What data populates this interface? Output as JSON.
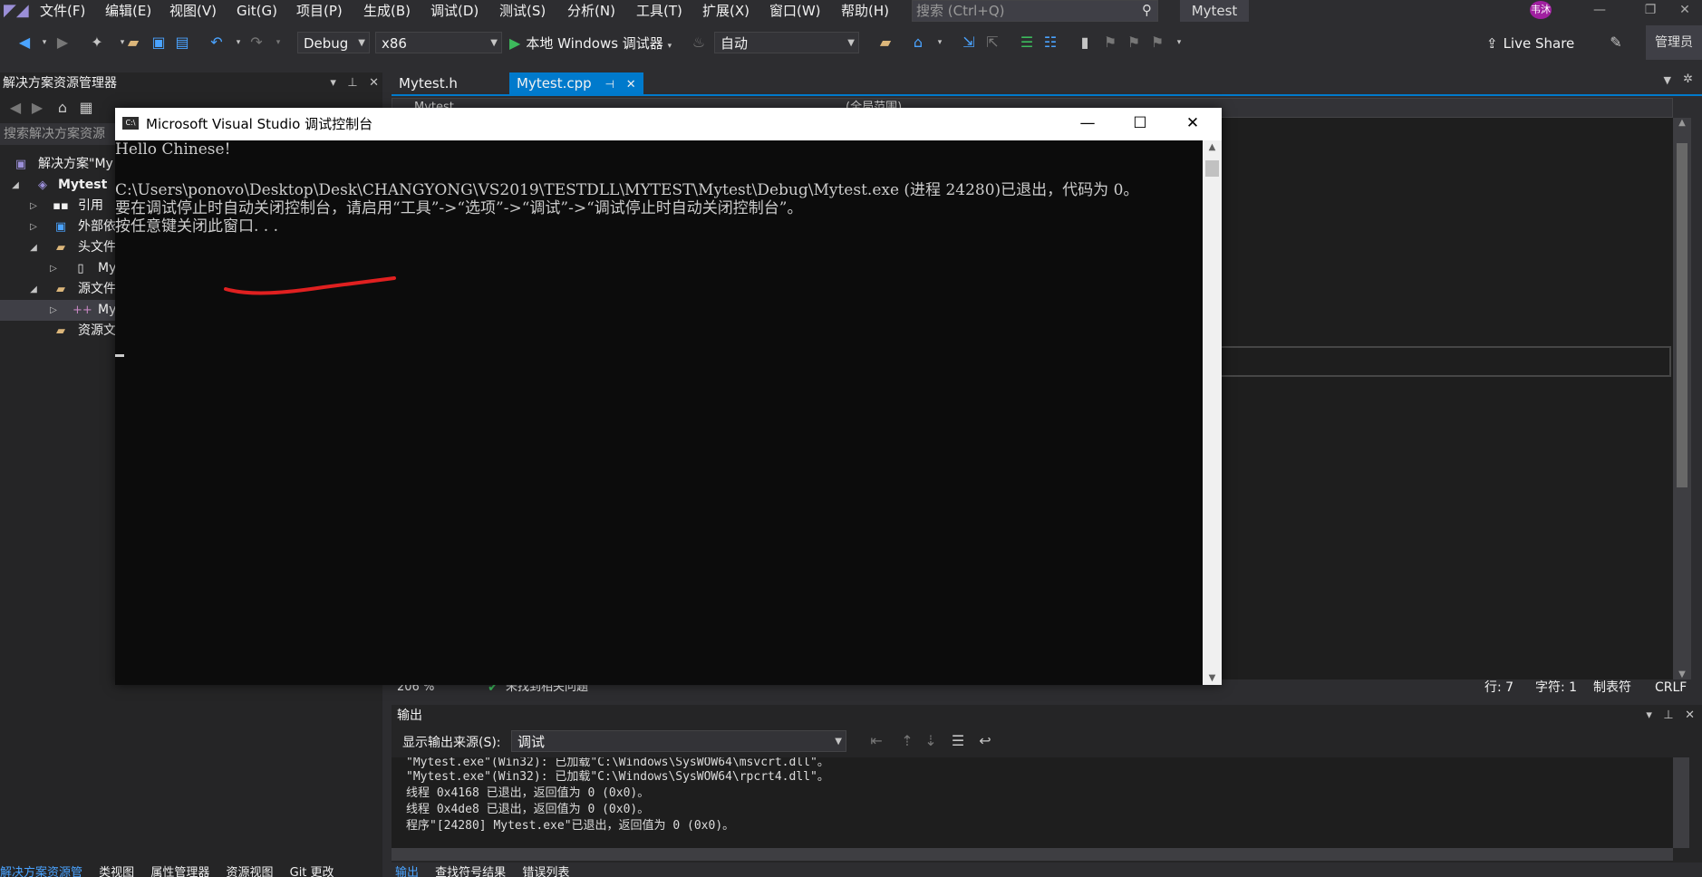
{
  "menubar": {
    "items": [
      "文件(F)",
      "编辑(E)",
      "视图(V)",
      "Git(G)",
      "项目(P)",
      "生成(B)",
      "调试(D)",
      "测试(S)",
      "分析(N)",
      "工具(T)",
      "扩展(X)",
      "窗口(W)",
      "帮助(H)"
    ],
    "search_placeholder": "搜索 (Ctrl+Q)",
    "solution_name": "Mytest",
    "avatar_text": "韦沐"
  },
  "toolbar": {
    "config": "Debug",
    "platform": "x86",
    "run_label": "本地 Windows 调试器",
    "auto": "自动",
    "live_share": "Live Share",
    "admin": "管理员"
  },
  "solexp": {
    "title": "解决方案资源管理器",
    "search_placeholder": "搜索解决方案资源",
    "tree": [
      {
        "label": "解决方案\"My"
      },
      {
        "label": "Mytest"
      },
      {
        "label": "引用"
      },
      {
        "label": "外部依"
      },
      {
        "label": "头文件"
      },
      {
        "label": "My"
      },
      {
        "label": "源文件"
      },
      {
        "label": "My"
      },
      {
        "label": "资源文"
      }
    ],
    "bottom_tabs": [
      "解决方案资源管",
      "类视图",
      "属性管理器",
      "资源视图",
      "Git 更改"
    ]
  },
  "editor": {
    "tabs": [
      {
        "label": "Mytest.h"
      },
      {
        "label": "Mytest.cpp",
        "active": true
      }
    ],
    "nav_left": "Mytest",
    "nav_right": "(全局范围)"
  },
  "statusline": {
    "zoom": "206 %",
    "issues": "未找到相关问题",
    "line": "行: 7",
    "char": "字符: 1",
    "tabs": "制表符",
    "eol": "CRLF"
  },
  "output": {
    "title": "输出",
    "source_label": "显示输出来源(S):",
    "source_value": "调试",
    "lines": [
      "\"Mytest.exe\"(Win32): 已加载\"C:\\Windows\\SysWOW64\\msvcrt.dll\"。",
      "\"Mytest.exe\"(Win32): 已加载\"C:\\Windows\\SysWOW64\\rpcrt4.dll\"。",
      "线程 0x4168 已退出，返回值为 0 (0x0)。",
      "线程 0x4de8 已退出，返回值为 0 (0x0)。",
      "程序\"[24280] Mytest.exe\"已退出，返回值为 0 (0x0)。"
    ],
    "bottom_tabs": [
      "输出",
      "查找符号结果",
      "错误列表"
    ]
  },
  "console": {
    "title": "Microsoft Visual Studio 调试控制台",
    "lines": [
      "Hello Chinese!",
      "",
      "C:\\Users\\ponovo\\Desktop\\Desk\\CHANGYONG\\VS2019\\TESTDLL\\MYTEST\\Mytest\\Debug\\Mytest.exe (进程 24280)已退出，代码为 0。",
      "要在调试停止时自动关闭控制台，请启用“工具”->“选项”->“调试”->“调试停止时自动关闭控制台”。",
      "按任意键关闭此窗口. . ."
    ]
  },
  "colors": {
    "accent": "#007acc",
    "annotation_red": "#e02020",
    "run_green": "#3dbb5c"
  }
}
